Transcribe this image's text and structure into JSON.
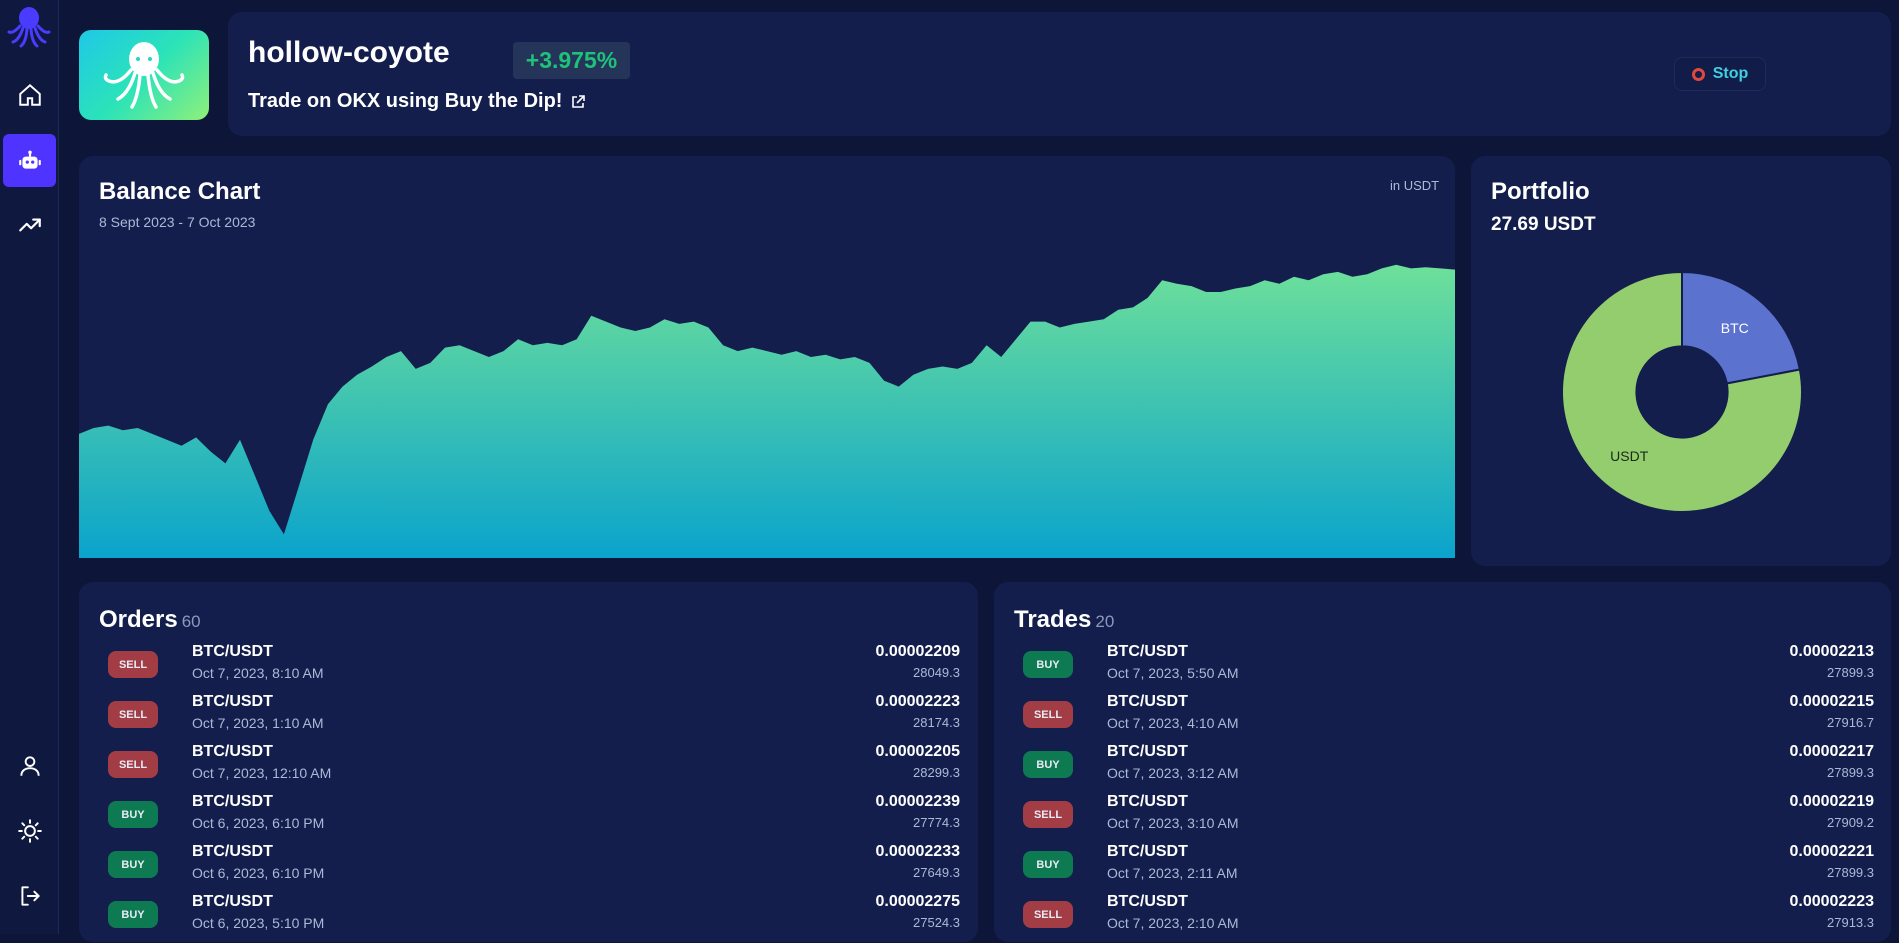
{
  "bot": {
    "name": "hollow-coyote",
    "change": "+3.975%",
    "subtitle": "Trade on OKX using Buy the Dip!",
    "stop_label": "Stop"
  },
  "balance": {
    "title": "Balance Chart",
    "date_range": "8 Sept 2023 - 7 Oct 2023",
    "unit": "in USDT"
  },
  "portfolio": {
    "title": "Portfolio",
    "total": "27.69 USDT"
  },
  "chart_data": [
    {
      "type": "area",
      "title": "Balance Chart",
      "unit": "USDT",
      "series": [
        {
          "values": [
            26.55,
            26.6,
            26.62,
            26.58,
            26.6,
            26.55,
            26.5,
            26.45,
            26.52,
            26.4,
            26.3,
            26.5,
            26.2,
            25.9,
            25.7,
            26.1,
            26.5,
            26.8,
            26.95,
            27.05,
            27.12,
            27.2,
            27.25,
            27.1,
            27.15,
            27.28,
            27.3,
            27.25,
            27.2,
            27.25,
            27.35,
            27.3,
            27.32,
            27.3,
            27.35,
            27.55,
            27.5,
            27.45,
            27.42,
            27.45,
            27.52,
            27.48,
            27.5,
            27.45,
            27.3,
            27.25,
            27.28,
            27.25,
            27.22,
            27.25,
            27.2,
            27.22,
            27.18,
            27.2,
            27.15,
            27.0,
            26.95,
            27.05,
            27.1,
            27.12,
            27.1,
            27.15,
            27.3,
            27.2,
            27.35,
            27.5,
            27.5,
            27.45,
            27.48,
            27.5,
            27.52,
            27.6,
            27.62,
            27.7,
            27.85,
            27.82,
            27.8,
            27.75,
            27.75,
            27.78,
            27.8,
            27.85,
            27.82,
            27.88,
            27.85,
            27.9,
            27.92,
            27.88,
            27.9,
            27.95,
            27.98,
            27.95,
            27.96,
            27.95,
            27.94
          ],
          "fill_gradient": [
            "#6ee09a",
            "#0aa3cc"
          ]
        }
      ]
    },
    {
      "type": "pie",
      "title": "Portfolio",
      "labels": [
        "BTC",
        "USDT"
      ],
      "values": [
        22,
        78
      ],
      "colors": [
        "#5b72cf",
        "#93cd6d"
      ],
      "hole": 0.38
    }
  ],
  "orders": {
    "title": "Orders",
    "count": "60",
    "rows": [
      {
        "side": "SELL",
        "pair": "BTC/USDT",
        "time": "Oct 7, 2023, 8:10 AM",
        "amount": "0.00002209",
        "price": "28049.3"
      },
      {
        "side": "SELL",
        "pair": "BTC/USDT",
        "time": "Oct 7, 2023, 1:10 AM",
        "amount": "0.00002223",
        "price": "28174.3"
      },
      {
        "side": "SELL",
        "pair": "BTC/USDT",
        "time": "Oct 7, 2023, 12:10 AM",
        "amount": "0.00002205",
        "price": "28299.3"
      },
      {
        "side": "BUY",
        "pair": "BTC/USDT",
        "time": "Oct 6, 2023, 6:10 PM",
        "amount": "0.00002239",
        "price": "27774.3"
      },
      {
        "side": "BUY",
        "pair": "BTC/USDT",
        "time": "Oct 6, 2023, 6:10 PM",
        "amount": "0.00002233",
        "price": "27649.3"
      },
      {
        "side": "BUY",
        "pair": "BTC/USDT",
        "time": "Oct 6, 2023, 5:10 PM",
        "amount": "0.00002275",
        "price": "27524.3"
      }
    ]
  },
  "trades": {
    "title": "Trades",
    "count": "20",
    "rows": [
      {
        "side": "BUY",
        "pair": "BTC/USDT",
        "time": "Oct 7, 2023, 5:50 AM",
        "amount": "0.00002213",
        "price": "27899.3"
      },
      {
        "side": "SELL",
        "pair": "BTC/USDT",
        "time": "Oct 7, 2023, 4:10 AM",
        "amount": "0.00002215",
        "price": "27916.7"
      },
      {
        "side": "BUY",
        "pair": "BTC/USDT",
        "time": "Oct 7, 2023, 3:12 AM",
        "amount": "0.00002217",
        "price": "27899.3"
      },
      {
        "side": "SELL",
        "pair": "BTC/USDT",
        "time": "Oct 7, 2023, 3:10 AM",
        "amount": "0.00002219",
        "price": "27909.2"
      },
      {
        "side": "BUY",
        "pair": "BTC/USDT",
        "time": "Oct 7, 2023, 2:11 AM",
        "amount": "0.00002221",
        "price": "27899.3"
      },
      {
        "side": "SELL",
        "pair": "BTC/USDT",
        "time": "Oct 7, 2023, 2:10 AM",
        "amount": "0.00002223",
        "price": "27913.3"
      }
    ]
  }
}
